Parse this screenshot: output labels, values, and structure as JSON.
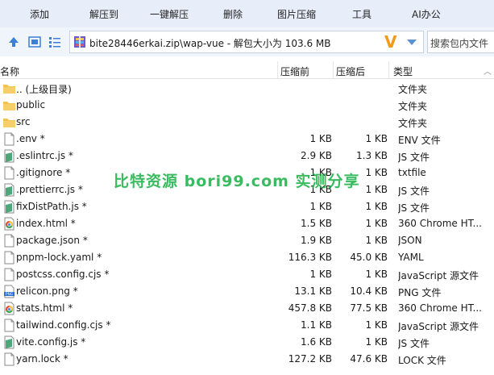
{
  "toolbar": {
    "items": [
      "添加",
      "解压到",
      "一键解压",
      "删除",
      "图片压缩",
      "工具",
      "AI办公"
    ]
  },
  "address": {
    "path": "bite28446erkai.zip\\wap-vue - 解包大小为 103.6 MB",
    "search_placeholder": "搜索包内文件"
  },
  "columns": {
    "name": "名称",
    "size": "压缩前",
    "packed": "压缩后",
    "type": "类型"
  },
  "files": [
    {
      "name": ".. (上级目录)",
      "size": "",
      "packed": "",
      "type": "文件夹",
      "icon": "folder-icon"
    },
    {
      "name": "public",
      "size": "",
      "packed": "",
      "type": "文件夹",
      "icon": "folder-icon"
    },
    {
      "name": "src",
      "size": "",
      "packed": "",
      "type": "文件夹",
      "icon": "folder-icon"
    },
    {
      "name": ".env *",
      "size": "1 KB",
      "packed": "1 KB",
      "type": "ENV 文件",
      "icon": "file-icon"
    },
    {
      "name": ".eslintrc.js *",
      "size": "2.9 KB",
      "packed": "1.3 KB",
      "type": "JS 文件",
      "icon": "js-file-icon"
    },
    {
      "name": ".gitignore *",
      "size": "1 KB",
      "packed": "1 KB",
      "type": "txtfile",
      "icon": "file-icon"
    },
    {
      "name": ".prettierrc.js *",
      "size": "1 KB",
      "packed": "1 KB",
      "type": "JS 文件",
      "icon": "js-file-icon"
    },
    {
      "name": "fixDistPath.js *",
      "size": "1 KB",
      "packed": "1 KB",
      "type": "JS 文件",
      "icon": "js-file-icon"
    },
    {
      "name": "index.html *",
      "size": "1.5 KB",
      "packed": "1 KB",
      "type": "360 Chrome HT...",
      "icon": "html-file-icon"
    },
    {
      "name": "package.json *",
      "size": "1.9 KB",
      "packed": "1 KB",
      "type": "JSON",
      "icon": "file-icon"
    },
    {
      "name": "pnpm-lock.yaml *",
      "size": "116.3 KB",
      "packed": "45.0 KB",
      "type": "YAML",
      "icon": "file-icon"
    },
    {
      "name": "postcss.config.cjs *",
      "size": "1 KB",
      "packed": "1 KB",
      "type": "JavaScript 源文件",
      "icon": "file-icon"
    },
    {
      "name": "relicon.png *",
      "size": "13.1 KB",
      "packed": "10.4 KB",
      "type": "PNG 文件",
      "icon": "png-file-icon"
    },
    {
      "name": "stats.html *",
      "size": "457.8 KB",
      "packed": "77.5 KB",
      "type": "360 Chrome HT...",
      "icon": "html-file-icon"
    },
    {
      "name": "tailwind.config.cjs *",
      "size": "1.1 KB",
      "packed": "1 KB",
      "type": "JavaScript 源文件",
      "icon": "file-icon"
    },
    {
      "name": "vite.config.js *",
      "size": "1.6 KB",
      "packed": "1 KB",
      "type": "JS 文件",
      "icon": "js-file-icon"
    },
    {
      "name": "yarn.lock *",
      "size": "127.2 KB",
      "packed": "47.6 KB",
      "type": "LOCK 文件",
      "icon": "file-icon"
    }
  ],
  "watermark": "比特资源 bori99.com 实测分享"
}
